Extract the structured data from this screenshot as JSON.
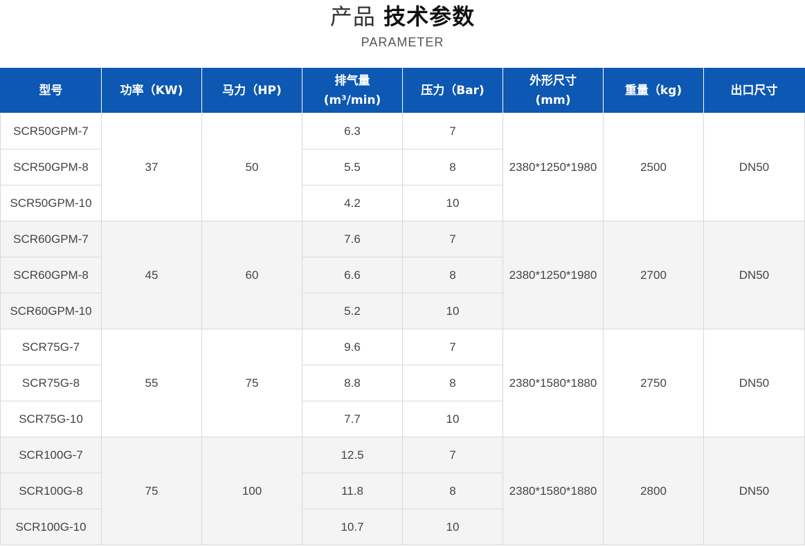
{
  "heading": {
    "title_light": "产品",
    "title_bold": "技术参数",
    "subtitle": "PARAMETER"
  },
  "table": {
    "headers": [
      {
        "lines": [
          "型号"
        ]
      },
      {
        "lines": [
          "功率（KW)"
        ]
      },
      {
        "lines": [
          "马力（HP)"
        ]
      },
      {
        "lines": [
          "排气量",
          "(m³/min)"
        ]
      },
      {
        "lines": [
          "压力（Bar)"
        ]
      },
      {
        "lines": [
          "外形尺寸",
          "(mm)"
        ]
      },
      {
        "lines": [
          "重量（kg)"
        ]
      },
      {
        "lines": [
          "出口尺寸"
        ]
      }
    ],
    "groups": [
      {
        "power_kw": "37",
        "horsepower": "50",
        "dimensions": "2380*1250*1980",
        "weight": "2500",
        "outlet": "DN50",
        "rows": [
          {
            "model": "SCR50GPM-7",
            "displacement": "6.3",
            "pressure": "7"
          },
          {
            "model": "SCR50GPM-8",
            "displacement": "5.5",
            "pressure": "8"
          },
          {
            "model": "SCR50GPM-10",
            "displacement": "4.2",
            "pressure": "10"
          }
        ]
      },
      {
        "power_kw": "45",
        "horsepower": "60",
        "dimensions": "2380*1250*1980",
        "weight": "2700",
        "outlet": "DN50",
        "rows": [
          {
            "model": "SCR60GPM-7",
            "displacement": "7.6",
            "pressure": "7"
          },
          {
            "model": "SCR60GPM-8",
            "displacement": "6.6",
            "pressure": "8"
          },
          {
            "model": "SCR60GPM-10",
            "displacement": "5.2",
            "pressure": "10"
          }
        ]
      },
      {
        "power_kw": "55",
        "horsepower": "75",
        "dimensions": "2380*1580*1880",
        "weight": "2750",
        "outlet": "DN50",
        "rows": [
          {
            "model": "SCR75G-7",
            "displacement": "9.6",
            "pressure": "7"
          },
          {
            "model": "SCR75G-8",
            "displacement": "8.8",
            "pressure": "8"
          },
          {
            "model": "SCR75G-10",
            "displacement": "7.7",
            "pressure": "10"
          }
        ]
      },
      {
        "power_kw": "75",
        "horsepower": "100",
        "dimensions": "2380*1580*1880",
        "weight": "2800",
        "outlet": "DN50",
        "rows": [
          {
            "model": "SCR100G-7",
            "displacement": "12.5",
            "pressure": "7"
          },
          {
            "model": "SCR100G-8",
            "displacement": "11.8",
            "pressure": "8"
          },
          {
            "model": "SCR100G-10",
            "displacement": "10.7",
            "pressure": "10"
          }
        ]
      }
    ]
  },
  "colors": {
    "header_bg": "#0d58b2",
    "header_text": "#ffffff",
    "row_alt_bg": "#f4f4f4",
    "border": "#d9d9d9"
  }
}
